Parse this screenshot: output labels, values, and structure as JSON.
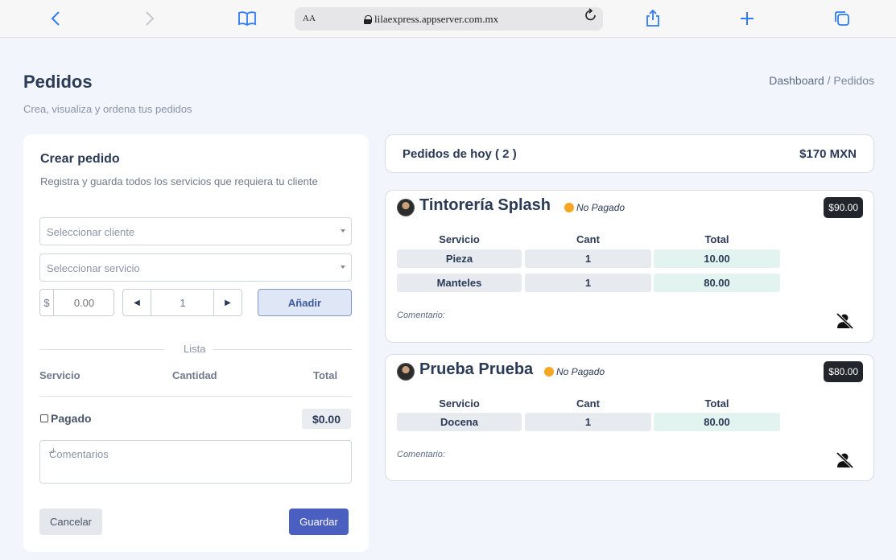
{
  "browser": {
    "text_size_label": "AA",
    "url": "lilaexpress.appserver.com.mx"
  },
  "page": {
    "title": "Pedidos",
    "subtitle": "Crea, visualiza y ordena tus pedidos",
    "breadcrumb": [
      "Dashboard",
      "/",
      "Pedidos"
    ]
  },
  "create_order": {
    "title": "Crear pedido",
    "subtitle": "Registra y guarda todos los servicios que requiera tu cliente",
    "client_placeholder": "Seleccionar cliente",
    "service_placeholder": "Seleccionar servicio",
    "currency_symbol": "$",
    "price_placeholder": "0.00",
    "quantity": "1",
    "add_label": "Añadir",
    "list_label": "Lista",
    "columns": [
      "Servicio",
      "Cantidad",
      "Total"
    ],
    "paid_label": "Pagado",
    "paid_checked": false,
    "total": "$0.00",
    "comments_placeholder": "Comentarios",
    "cancel_label": "Cancelar",
    "save_label": "Guardar"
  },
  "today": {
    "label": "Pedidos de hoy ( 2 )",
    "total": "$170 MXN"
  },
  "orders": [
    {
      "client": "Tintorería Splash",
      "status": "No Pagado",
      "amount": "$90.00",
      "columns": [
        "Servicio",
        "Cant",
        "Total"
      ],
      "rows": [
        {
          "service": "Pieza",
          "qty": "1",
          "total": "10.00"
        },
        {
          "service": "Manteles",
          "qty": "1",
          "total": "80.00"
        }
      ],
      "comment_label": "Comentario:"
    },
    {
      "client": "Prueba Prueba",
      "status": "No Pagado",
      "amount": "$80.00",
      "columns": [
        "Servicio",
        "Cant",
        "Total"
      ],
      "rows": [
        {
          "service": "Docena",
          "qty": "1",
          "total": "80.00"
        }
      ],
      "comment_label": "Comentario:"
    }
  ],
  "colors": {
    "status_unpaid": "#f5a623",
    "primary": "#4a5fbf",
    "browser_accent": "#2f7cf6"
  },
  "icons": [
    "back-icon",
    "forward-icon",
    "bookmarks-icon",
    "lock-icon",
    "reload-icon",
    "share-icon",
    "new-tab-icon",
    "tabs-icon",
    "no-user-icon"
  ]
}
